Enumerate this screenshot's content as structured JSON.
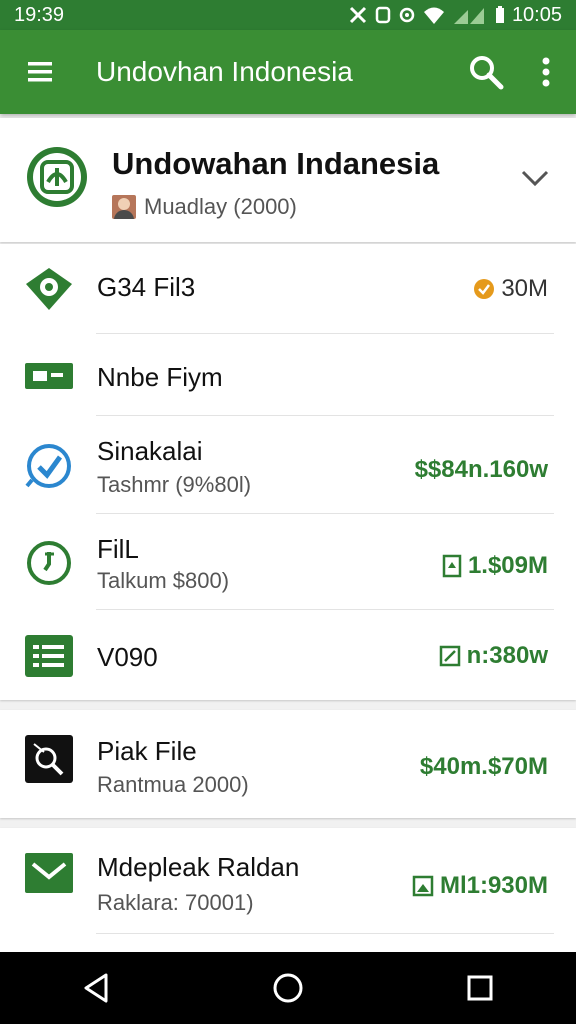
{
  "status": {
    "time_left": "19:39",
    "time_right": "10:05"
  },
  "appbar": {
    "title": "Undovhan Indonesia"
  },
  "header": {
    "title": "Undowahan Indanesia",
    "subtitle": "Muadlay (2000)"
  },
  "rows": [
    {
      "title": "G34 Fil3",
      "subtitle": "",
      "value": "30M",
      "icon": "shield-icon"
    },
    {
      "title": "Nnbe Fiym",
      "subtitle": "",
      "value": "",
      "icon": "id-card-icon"
    },
    {
      "title": "Sinakalai",
      "subtitle": "Tashmr (9%80l)",
      "value": "$$84n.160w",
      "icon": "check-circle-icon"
    },
    {
      "title": "FilL",
      "subtitle": "Talkum $800)",
      "value": "1.$09M",
      "icon": "clock-icon"
    },
    {
      "title": "V090",
      "subtitle": "",
      "value": "n:380w",
      "icon": "list-icon"
    }
  ],
  "card1": {
    "title": "Piak File",
    "subtitle": "Rantmua 2000)",
    "value": "$40m.$70M",
    "icon": "magnifier-icon"
  },
  "card2": {
    "title": "Mdepleak Raldan",
    "subtitle": "Raklara: 70001)",
    "value": "Ml1:930M",
    "icon": "mail-icon"
  },
  "colors": {
    "primary": "#3a8e34",
    "status": "#2e7d32",
    "value_green": "#2e7d32",
    "badge_orange": "#e59a1c"
  }
}
